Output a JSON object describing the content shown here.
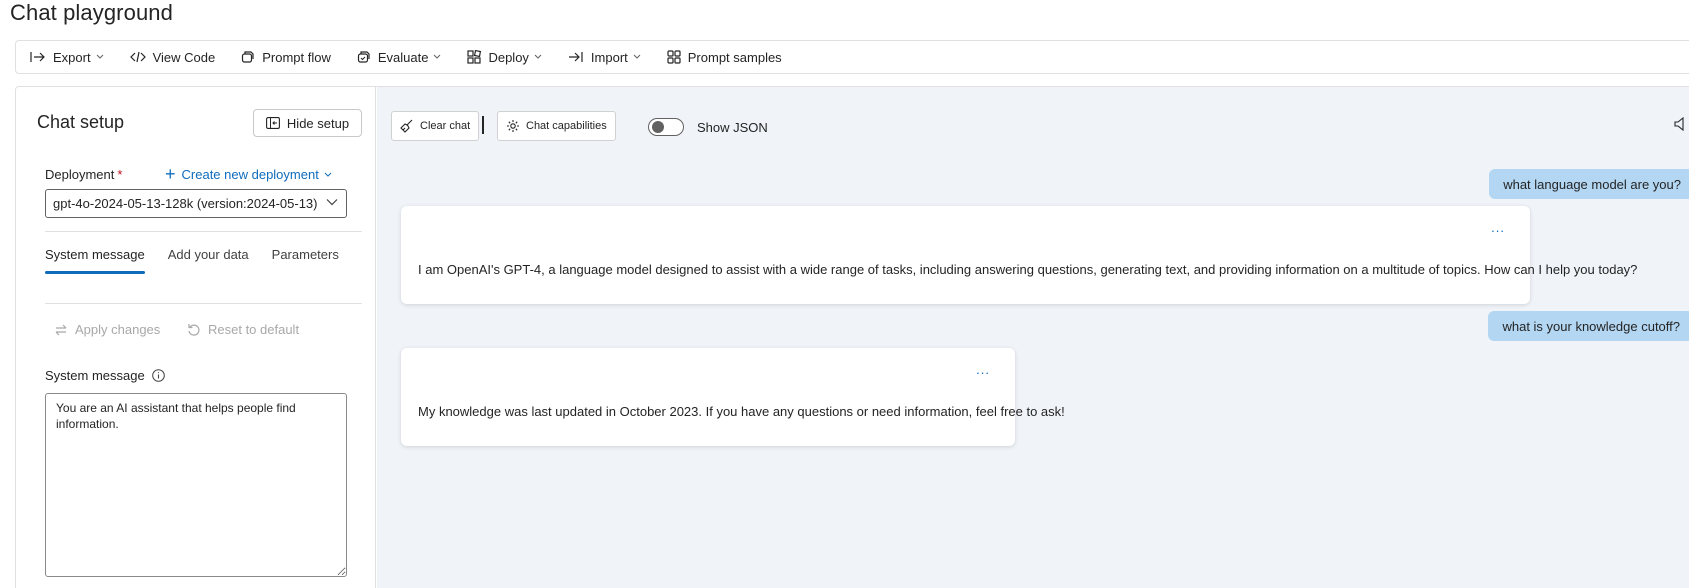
{
  "page": {
    "title": "Chat playground"
  },
  "toolbar": {
    "items": [
      {
        "label": "Export"
      },
      {
        "label": "View Code"
      },
      {
        "label": "Prompt flow"
      },
      {
        "label": "Evaluate"
      },
      {
        "label": "Deploy"
      },
      {
        "label": "Import"
      },
      {
        "label": "Prompt samples"
      }
    ]
  },
  "setup": {
    "title": "Chat setup",
    "hide_label": "Hide setup",
    "deployment_label": "Deployment",
    "required_mark": "*",
    "create_link": "Create new deployment",
    "deployment_value": "gpt-4o-2024-05-13-128k (version:2024-05-13)",
    "tabs": [
      {
        "label": "System message",
        "active": true
      },
      {
        "label": "Add your data",
        "active": false
      },
      {
        "label": "Parameters",
        "active": false
      }
    ],
    "apply_label": "Apply changes",
    "reset_label": "Reset to default",
    "system_message_label": "System message",
    "system_message_value": "You are an AI assistant that helps people find information."
  },
  "chat": {
    "clear_label": "Clear chat",
    "capabilities_label": "Chat capabilities",
    "show_json_label": "Show JSON",
    "show_json_on": false,
    "more_label": "...",
    "messages": [
      {
        "role": "user",
        "text": "what language model are you?"
      },
      {
        "role": "assistant",
        "text": "I am OpenAI's GPT-4, a language model designed to assist with a wide range of tasks, including answering questions, generating text, and providing information on a multitude of topics. How can I help you today?"
      },
      {
        "role": "user",
        "text": "what is your knowledge cutoff?"
      },
      {
        "role": "assistant",
        "text": "My knowledge was last updated in October 2023. If you have any questions or need information, feel free to ask!"
      }
    ]
  },
  "colors": {
    "accent": "#0f6cbd",
    "user_bubble": "#b3d6f3",
    "chat_background": "#f0f4f9",
    "required": "#c50f1f"
  }
}
